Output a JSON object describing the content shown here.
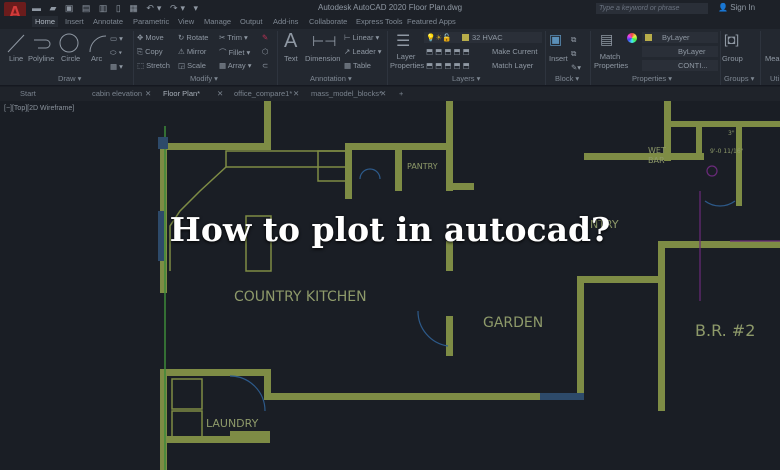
{
  "app": {
    "title": "Autodesk AutoCAD 2020   Floor Plan.dwg",
    "search_placeholder": "Type a keyword or phrase",
    "sign_in": "Sign In",
    "logo": "A"
  },
  "ribbon_tabs": [
    "Home",
    "Insert",
    "Annotate",
    "Parametric",
    "View",
    "Manage",
    "Output",
    "Add-ins",
    "Collaborate",
    "Express Tools",
    "Featured Apps"
  ],
  "draw": {
    "line": "Line",
    "polyline": "Polyline",
    "circle": "Circle",
    "arc": "Arc",
    "label": "Draw ▾"
  },
  "modify": {
    "move": "Move",
    "rotate": "Rotate",
    "trim": "Trim ▾",
    "copy": "Copy",
    "mirror": "Mirror",
    "fillet": "Fillet ▾",
    "stretch": "Stretch",
    "scale": "Scale",
    "array": "Array ▾",
    "label": "Modify ▾"
  },
  "annotation": {
    "text": "Text",
    "dimension": "Dimension",
    "linear": "Linear ▾",
    "leader": "Leader ▾",
    "table": "Table",
    "label": "Annotation ▾"
  },
  "layers": {
    "layer_properties": "Layer Properties",
    "current_layer": "32 HVAC",
    "make_current": "Make Current",
    "match_layer": "Match Layer",
    "label": "Layers ▾"
  },
  "block": {
    "insert": "Insert",
    "label": "Block ▾"
  },
  "properties": {
    "match_properties": "Match Properties",
    "color": "ByLayer",
    "linetype": "ByLayer",
    "lineweight": "CONTI...",
    "label": "Properties ▾"
  },
  "groups": {
    "group": "Group",
    "label": "Groups ▾"
  },
  "utilities": {
    "measure": "Meas",
    "label": "Uti"
  },
  "doc_tabs": [
    "Start",
    "cabin elevation",
    "Floor Plan*",
    "office_compare1*",
    "mass_model_blocks*"
  ],
  "view_label": "[−][Top][2D Wireframe]",
  "plan_labels": {
    "pantry": "PANTRY",
    "wet": "WET",
    "bar": "BAR",
    "dim": "9'-0 11/16\"",
    "dim2": "3\"",
    "kitchen": "COUNTRY KITCHEN",
    "garden": "GARDEN",
    "br2": "B.R. #2",
    "laundry": "LAUNDRY",
    "entry": "NTRY"
  },
  "overlay_title": "How to plot in autocad?"
}
